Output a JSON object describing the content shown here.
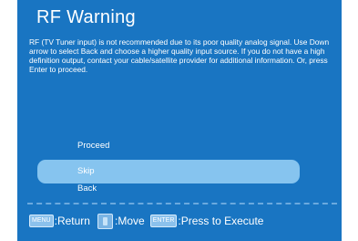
{
  "dialog": {
    "title": "RF Warning",
    "message": "RF (TV Tuner input) is not recommended due to its poor quality analog signal. Use Down arrow to select Back and choose a higher quality input source. If you do not have a high definition output, contact your cable/satellite provider for additional information. Or, press Enter to proceed."
  },
  "menu": {
    "items": [
      {
        "label": "Proceed",
        "selected": false
      },
      {
        "label": "Skip",
        "selected": true
      },
      {
        "label": "Back",
        "selected": false
      }
    ]
  },
  "footer": {
    "menu_key": "MENU",
    "menu_action": ":Return",
    "move_action": ":Move",
    "enter_key": "ENTER",
    "enter_action": ":Press to Execute"
  },
  "colors": {
    "background": "#1975c2",
    "highlight": "#86c4ef",
    "text": "#ffffff"
  }
}
